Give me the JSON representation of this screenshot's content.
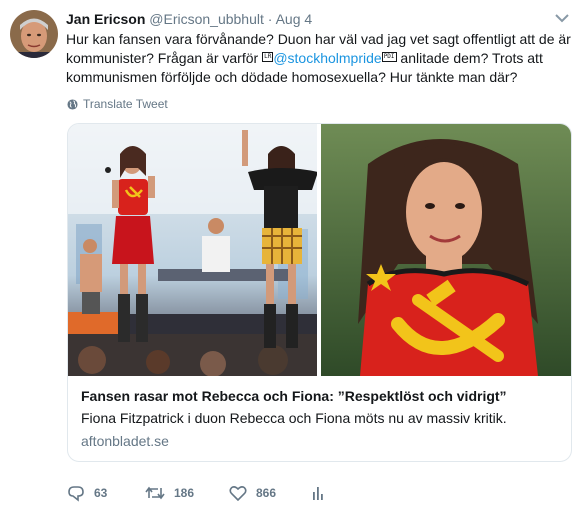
{
  "author": {
    "name": "Jan Ericson",
    "handle": "@Ericson_ubbhult",
    "separator": "·",
    "time": "Aug 4"
  },
  "tweet": {
    "text_part1": "Hur kan fansen vara förvånande? Duon har väl vad jag vet sagt offentligt att de är kommunister? Frågan är varför ",
    "flag_left": "LR",
    "mention": "@stockholmpride",
    "flag_right": "PDI",
    "text_part2": " anlitade dem? Trots att kommunismen förföljde och dödade homosexuella? Hur tänkte man där?"
  },
  "translate_label": "Translate Tweet",
  "card": {
    "title": "Fansen rasar mot Rebecca och Fiona: ”Respektlöst och vidrigt”",
    "description": "Fiona Fitzpatrick i duon Rebecca och Fiona möts nu av massiv kritik.",
    "domain": "aftonbladet.se"
  },
  "actions": {
    "reply_count": "63",
    "retweet_count": "186",
    "like_count": "866"
  },
  "icons": {
    "caret": "chevron-down-icon",
    "translate": "globe-icon",
    "reply": "reply-icon",
    "retweet": "retweet-icon",
    "like": "heart-icon",
    "analytics": "analytics-icon"
  },
  "colors": {
    "link": "#1b95e0",
    "secondary_text": "#657786",
    "border": "#e1e8ed",
    "shirt_red": "#d8221c",
    "hammer_sickle_yellow": "#f2c41a"
  }
}
